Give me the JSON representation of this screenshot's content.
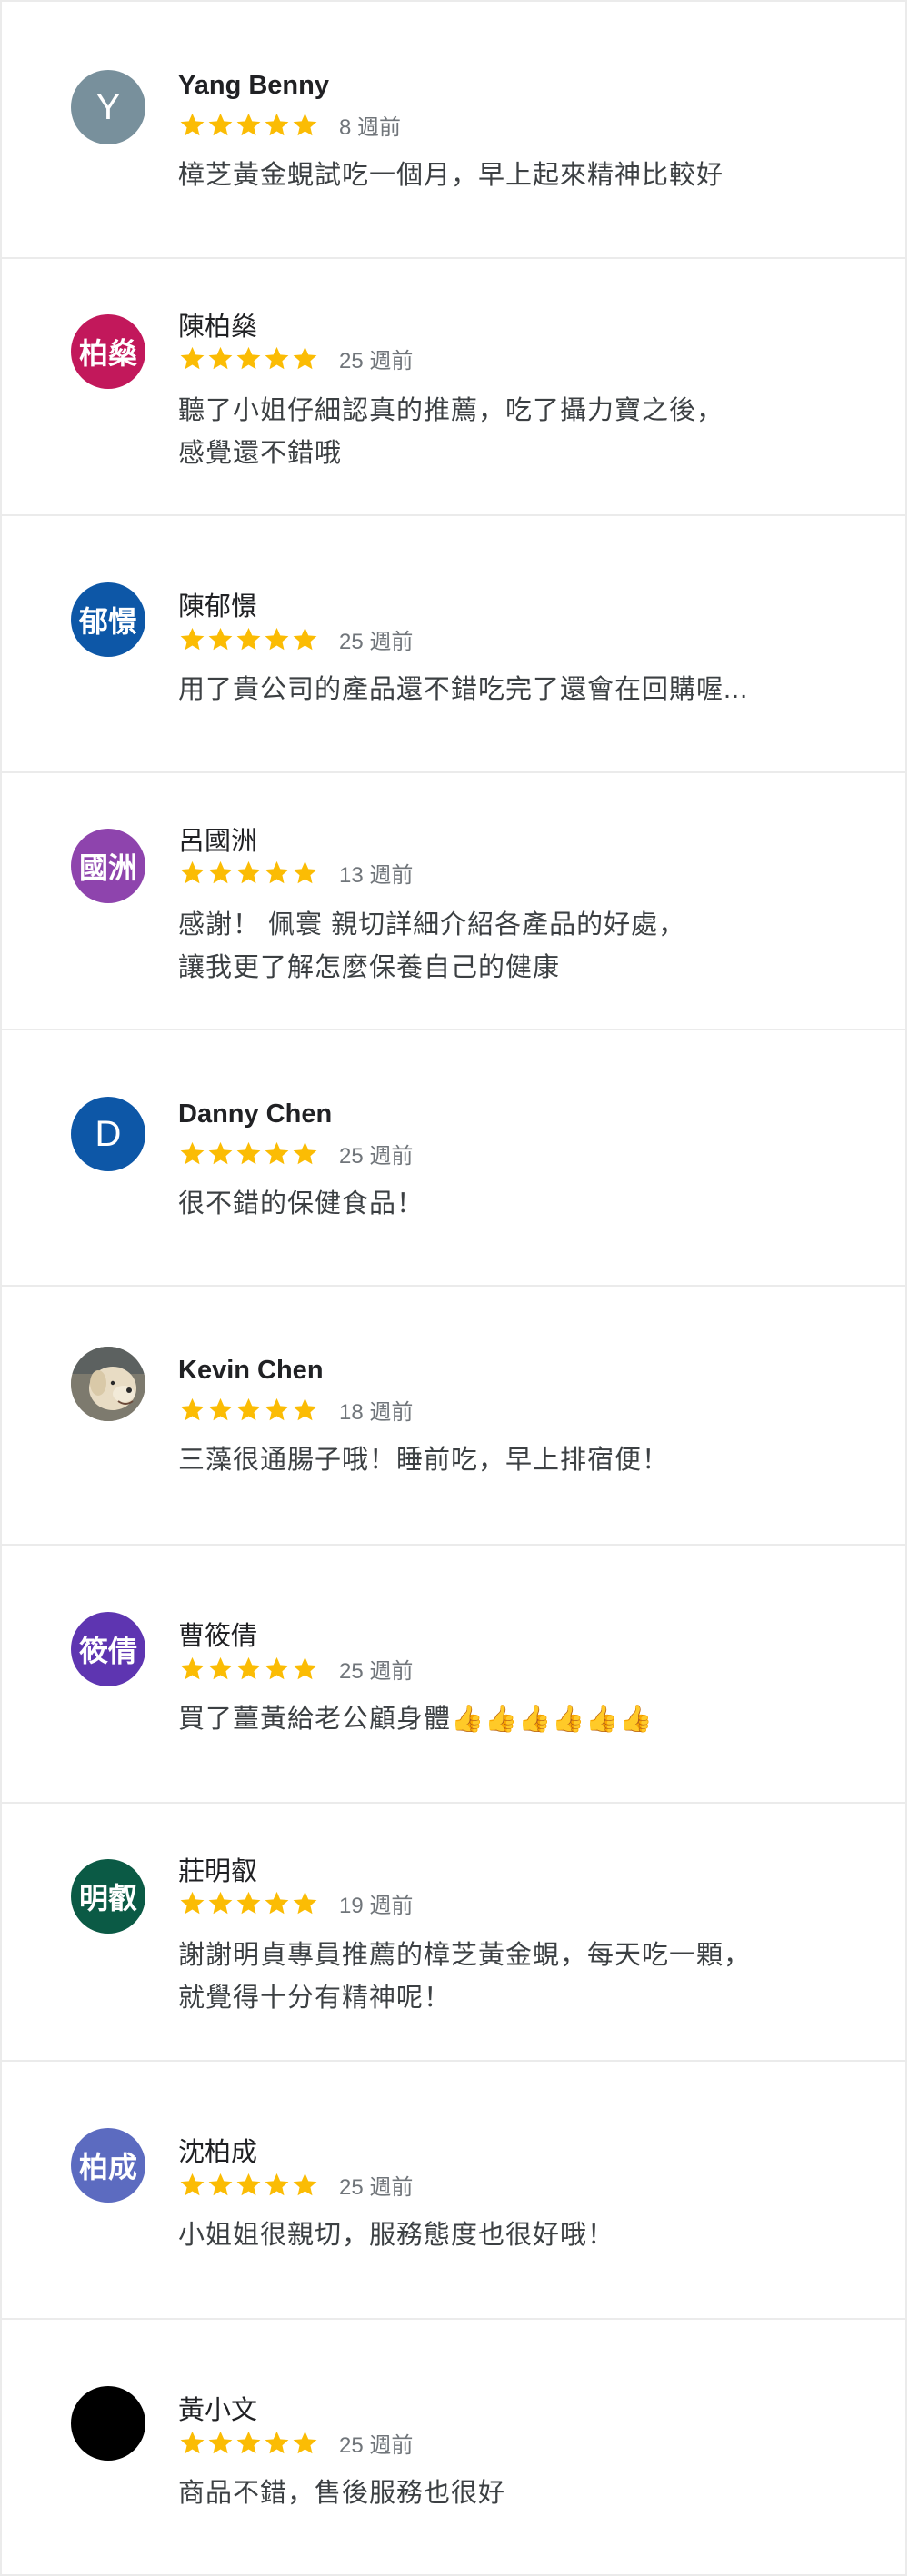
{
  "reviews": [
    {
      "name": "Yang Benny",
      "avatar_text": "Y",
      "avatar_color": "#78909c",
      "time": "8 週前",
      "text": "樟芝黃金蜆試吃一個月，早上起來精神比較好",
      "rating": 5
    },
    {
      "name": "陳柏燊",
      "avatar_text": "柏燊",
      "avatar_color": "#c2185b",
      "time": "25 週前",
      "text": "聽了小姐仔細認真的推薦，吃了攝力寶之後，\n感覺還不錯哦",
      "rating": 5
    },
    {
      "name": "陳郁憬",
      "avatar_text": "郁憬",
      "avatar_color": "#0d57a7",
      "time": "25 週前",
      "text": "用了貴公司的產品還不錯吃完了還會在回購喔...",
      "rating": 5
    },
    {
      "name": "呂國洲",
      "avatar_text": "國洲",
      "avatar_color": "#8e44ad",
      "time": "13 週前",
      "text": "感謝！ 佩寰 親切詳細介紹各產品的好處，\n讓我更了解怎麼保養自己的健康",
      "rating": 5
    },
    {
      "name": "Danny Chen",
      "avatar_text": "D",
      "avatar_color": "#0d57a7",
      "time": "25 週前",
      "text": "很不錯的保健食品！",
      "rating": 5
    },
    {
      "name": "Kevin Chen",
      "avatar_text": "",
      "avatar_color": "#8d8677",
      "time": "18 週前",
      "text": "三藻很通腸子哦！睡前吃，早上排宿便！",
      "rating": 5
    },
    {
      "name": "曹筱倩",
      "avatar_text": "筱倩",
      "avatar_color": "#5e35b1",
      "time": "25 週前",
      "text": "買了薑黃給老公顧身體👍👍👍👍👍👍",
      "rating": 5
    },
    {
      "name": "莊明叡",
      "avatar_text": "明叡",
      "avatar_color": "#0b5a45",
      "time": "19 週前",
      "text": "謝謝明貞專員推薦的樟芝黃金蜆，每天吃一顆，\n就覺得十分有精神呢！",
      "rating": 5
    },
    {
      "name": "沈柏成",
      "avatar_text": "柏成",
      "avatar_color": "#5c6bc0",
      "time": "25 週前",
      "text": "小姐姐很親切，服務態度也很好哦！",
      "rating": 5
    },
    {
      "name": "黃小文",
      "avatar_text": "",
      "avatar_color": "#000000",
      "time": "25 週前",
      "text": "商品不錯，售後服務也很好",
      "rating": 5
    }
  ],
  "colors": {
    "star": "#fbbc04",
    "meta_text": "#70757a",
    "divider": "#ebebeb"
  }
}
